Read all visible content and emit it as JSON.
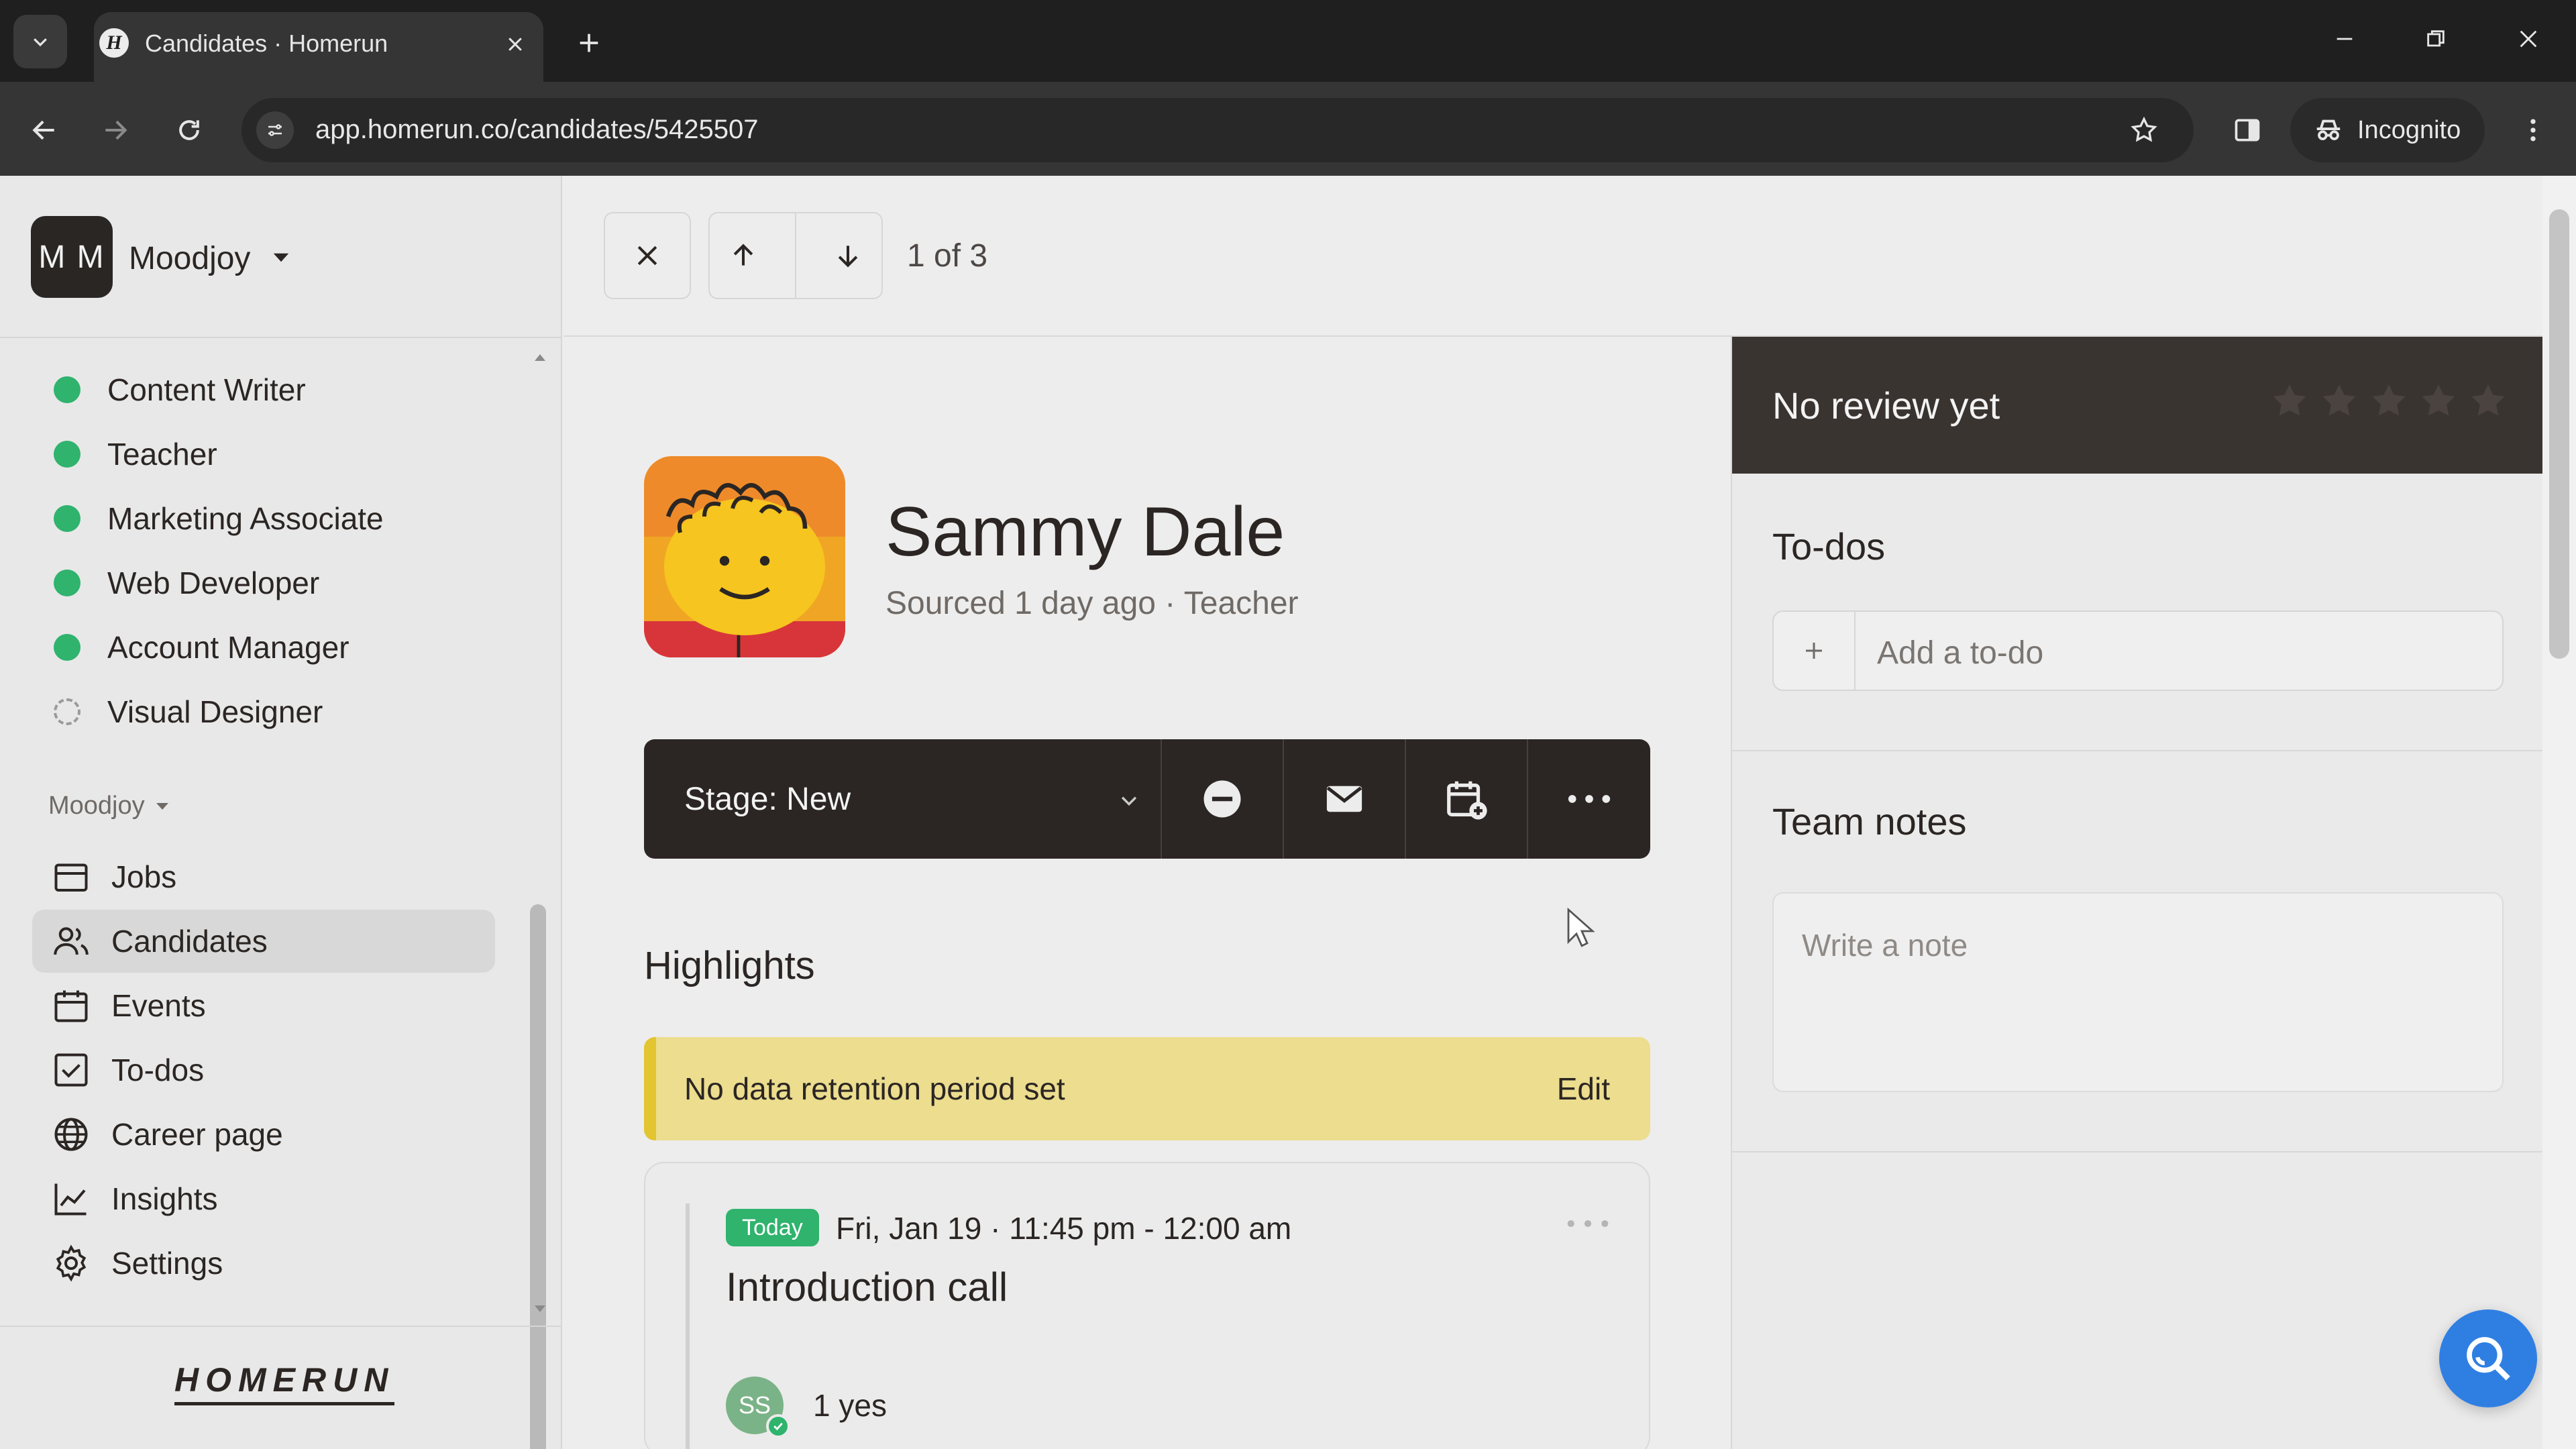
{
  "browser": {
    "tab_title": "Candidates · Homerun",
    "favicon_letter": "H",
    "url": "app.homerun.co/candidates/5425507",
    "incognito_label": "Incognito"
  },
  "sidebar": {
    "workspace_initials": "M M",
    "workspace_name": "Moodjoy",
    "jobs": [
      {
        "label": "Content Writer",
        "status": "active"
      },
      {
        "label": "Teacher",
        "status": "active"
      },
      {
        "label": "Marketing Associate",
        "status": "active"
      },
      {
        "label": "Web Developer",
        "status": "active"
      },
      {
        "label": "Account Manager",
        "status": "active"
      },
      {
        "label": "Visual Designer",
        "status": "draft"
      }
    ],
    "section_label": "Moodjoy",
    "nav": [
      {
        "label": "Jobs",
        "icon": "briefcase-icon"
      },
      {
        "label": "Candidates",
        "icon": "users-icon",
        "active": true
      },
      {
        "label": "Events",
        "icon": "calendar-icon"
      },
      {
        "label": "To-dos",
        "icon": "checkbox-icon"
      },
      {
        "label": "Career page",
        "icon": "globe-icon"
      },
      {
        "label": "Insights",
        "icon": "chart-icon"
      },
      {
        "label": "Settings",
        "icon": "gear-icon"
      }
    ],
    "logo_text": "HOMERUN"
  },
  "topbar": {
    "pager": "1 of 3"
  },
  "candidate": {
    "name": "Sammy Dale",
    "meta": "Sourced 1 day ago · Teacher",
    "stage_label": "Stage: New"
  },
  "highlights": {
    "title": "Highlights",
    "retention_text": "No data retention period set",
    "retention_edit": "Edit"
  },
  "event": {
    "badge": "Today",
    "time": "Fri, Jan 19 · 11:45 pm - 12:00 am",
    "title": "Introduction call",
    "attendee_initials": "SS",
    "attendee_summary": "1 yes"
  },
  "review": {
    "title": "No review yet",
    "stars_total": 5
  },
  "todos": {
    "title": "To-dos",
    "placeholder": "Add a to-do"
  },
  "notes": {
    "title": "Team notes",
    "placeholder": "Write a note"
  },
  "colors": {
    "active_green": "#2fb36d",
    "dark_bar": "#2b2624",
    "retention_bg": "#ecdd8f",
    "help_blue": "#2f7fe3"
  }
}
